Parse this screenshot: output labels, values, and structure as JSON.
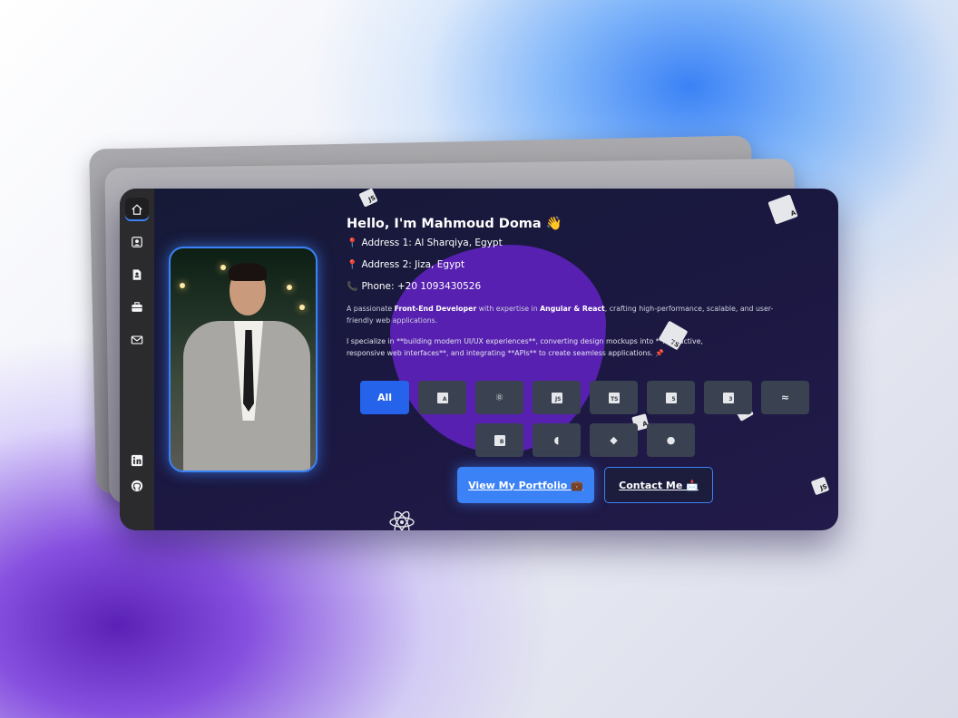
{
  "sidebar": {
    "items": [
      {
        "icon": "home-icon"
      },
      {
        "icon": "profile-icon"
      },
      {
        "icon": "resume-icon"
      },
      {
        "icon": "briefcase-icon"
      },
      {
        "icon": "mail-icon"
      }
    ],
    "social": [
      {
        "icon": "linkedin-icon"
      },
      {
        "icon": "github-icon"
      }
    ]
  },
  "profile": {
    "title": "Hello, I'm Mahmoud Doma 👋",
    "address1": "Address 1: Al Sharqiya, Egypt",
    "address2": "Address 2: Jiza, Egypt",
    "phone": "Phone: +20 1093430526",
    "desc_pre": "A passionate ",
    "desc_bold1": "Front-End Developer",
    "desc_mid": " with expertise in ",
    "desc_bold2": "Angular & React",
    "desc_post": ", crafting high-performance, scalable, and user-friendly web applications.",
    "desc2": "I specialize in **building modern UI/UX experiences**, converting design mockups into **interactive, responsive web interfaces**, and integrating **APIs** to create seamless applications. 📌"
  },
  "filters": {
    "all_label": "All",
    "row1": [
      {
        "icon": "angular-icon",
        "label": "A"
      },
      {
        "icon": "react-icon",
        "label": "⚛"
      },
      {
        "icon": "javascript-icon",
        "label": "JS"
      },
      {
        "icon": "typescript-icon",
        "label": "TS"
      },
      {
        "icon": "html5-icon",
        "label": "5"
      },
      {
        "icon": "css3-icon",
        "label": "3"
      },
      {
        "icon": "tailwind-icon",
        "label": "≈"
      }
    ],
    "row2": [
      {
        "icon": "bootstrap-icon",
        "label": "B"
      },
      {
        "icon": "jquery-icon",
        "label": "◖"
      },
      {
        "icon": "git-icon",
        "label": "◆"
      },
      {
        "icon": "github-icon",
        "label": "●"
      }
    ]
  },
  "actions": {
    "portfolio_label": "View My Portfolio 💼",
    "contact_label": "Contact Me 📩"
  },
  "colors": {
    "accent": "#3b82f6",
    "blob": "#5b21b6",
    "card_bg": "#1a1840",
    "sidebar_bg": "#2b2b2e"
  }
}
